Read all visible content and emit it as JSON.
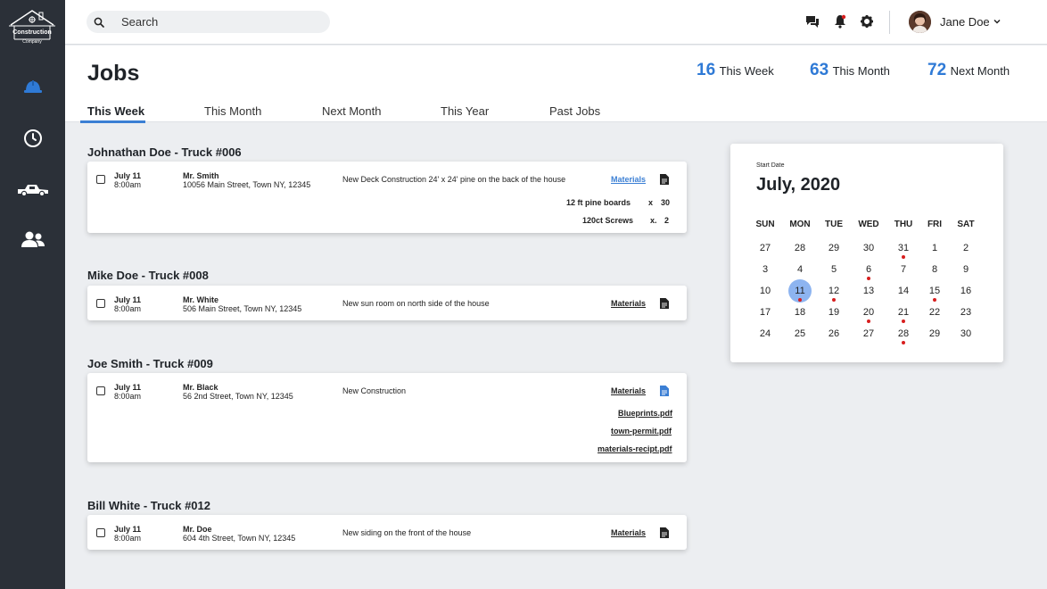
{
  "brand": {
    "logo_text": "Construction",
    "logo_sub": "Company"
  },
  "search": {
    "placeholder": "Search"
  },
  "user": {
    "name": "Jane Doe"
  },
  "page": {
    "title": "Jobs"
  },
  "stats": [
    {
      "value": "16",
      "label": "This Week"
    },
    {
      "value": "63",
      "label": "This Month"
    },
    {
      "value": "72",
      "label": "Next Month"
    }
  ],
  "tabs": [
    {
      "label": "This Week",
      "active": true
    },
    {
      "label": "This Month",
      "active": false
    },
    {
      "label": "Next Month",
      "active": false
    },
    {
      "label": "This Year",
      "active": false
    },
    {
      "label": "Past Jobs",
      "active": false
    }
  ],
  "jobs": [
    {
      "truck": "Johnathan Doe - Truck #006",
      "date": "July 11",
      "time": "8:00am",
      "client": "Mr. Smith",
      "address": "10056 Main Street, Town NY, 12345",
      "description": "New Deck Construction 24' x 24' pine on the back of the house",
      "materials_label": "Materials",
      "materials": [
        {
          "item": "12 ft pine boards",
          "qty_prefix": "x",
          "qty": "30"
        },
        {
          "item": "120ct Screws",
          "qty_prefix": "x.",
          "qty": "2"
        }
      ]
    },
    {
      "truck": "Mike Doe - Truck #008",
      "date": "July 11",
      "time": "8:00am",
      "client": "Mr. White",
      "address": "506 Main Street, Town NY, 12345",
      "description": "New sun room on north side of the house",
      "materials_label": "Materials"
    },
    {
      "truck": "Joe Smith - Truck #009",
      "date": "July 11",
      "time": "8:00am",
      "client": "Mr. Black",
      "address": "56 2nd Street, Town NY, 12345",
      "description": "New Construction",
      "materials_label": "Materials",
      "files": [
        "Blueprints.pdf",
        "town-permit.pdf",
        "materials-recipt.pdf"
      ]
    },
    {
      "truck": "Bill White - Truck #012",
      "date": "July 11",
      "time": "8:00am",
      "client": "Mr. Doe",
      "address": "604 4th Street, Town NY, 12345",
      "description": "New siding on the front of the house",
      "materials_label": "Materials"
    }
  ],
  "calendar": {
    "caption": "Start Date",
    "month": "July, 2020",
    "weekdays": [
      "SUN",
      "MON",
      "TUE",
      "WED",
      "THU",
      "FRI",
      "SAT"
    ],
    "weeks": [
      [
        "27",
        "28",
        "29",
        "30",
        "31",
        "1",
        "2"
      ],
      [
        "3",
        "4",
        "5",
        "6",
        "7",
        "8",
        "9"
      ],
      [
        "10",
        "11",
        "12",
        "13",
        "14",
        "15",
        "16"
      ],
      [
        "17",
        "18",
        "19",
        "20",
        "21",
        "22",
        "23"
      ],
      [
        "24",
        "25",
        "26",
        "27",
        "28",
        "29",
        "30"
      ]
    ],
    "selected_day": "11",
    "event_days": [
      "31",
      "6",
      "11",
      "12",
      "15",
      "20",
      "21",
      "28"
    ]
  },
  "colors": {
    "accent": "#2f7ad6",
    "sidebar": "#2b3038",
    "event_dot": "#d81e1e",
    "selected": "#8db4f0"
  }
}
